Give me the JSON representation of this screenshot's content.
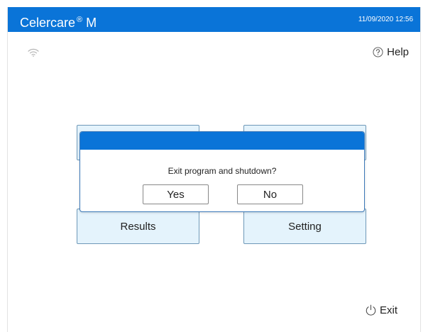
{
  "header": {
    "app_name": "Celercare",
    "registered_mark": "®",
    "model": "M",
    "datetime": "11/09/2020 12:56",
    "bar_color": "#0a74d8"
  },
  "status": {
    "wifi_icon": "wifi-icon"
  },
  "help": {
    "icon": "question-circle-icon",
    "label": "Help"
  },
  "menu": {
    "items": [
      {
        "label": ""
      },
      {
        "label": ""
      },
      {
        "label": "Results"
      },
      {
        "label": "Setting"
      }
    ],
    "button_color": "#e4f3fc"
  },
  "dialog": {
    "message": "Exit program and shutdown?",
    "yes_label": "Yes",
    "no_label": "No"
  },
  "exit": {
    "icon": "power-icon",
    "label": "Exit"
  }
}
